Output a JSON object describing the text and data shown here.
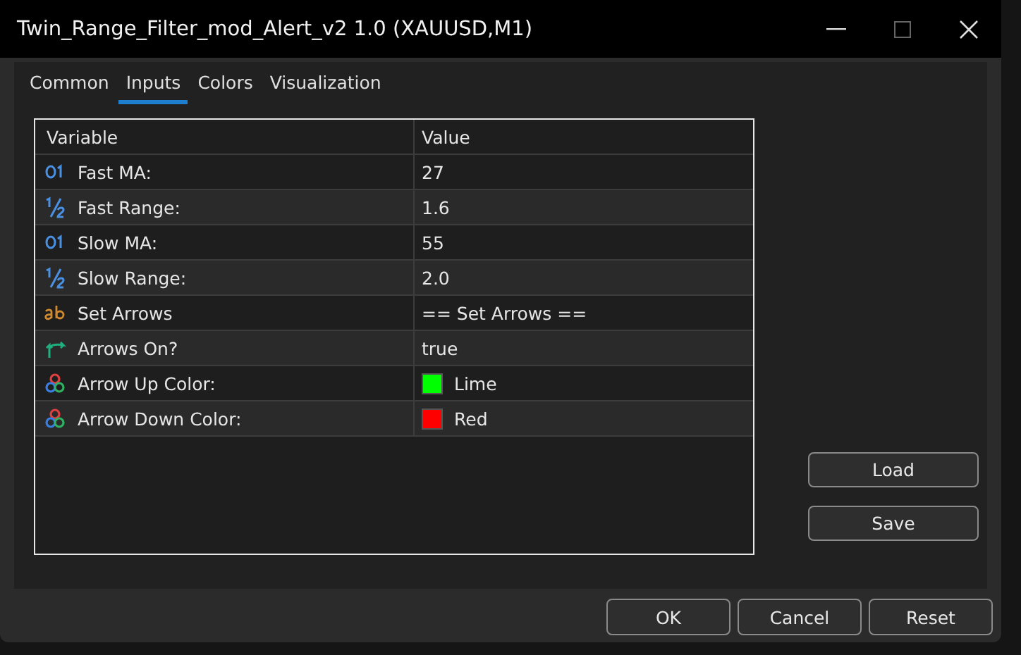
{
  "window": {
    "title": "Twin_Range_Filter_mod_Alert_v2 1.0 (XAUUSD,M1)"
  },
  "tabs": [
    {
      "label": "Common",
      "selected": false
    },
    {
      "label": "Inputs",
      "selected": true
    },
    {
      "label": "Colors",
      "selected": false
    },
    {
      "label": "Visualization",
      "selected": false
    }
  ],
  "table": {
    "columns": [
      "Variable",
      "Value"
    ],
    "rows": [
      {
        "kind": "int",
        "variable": "Fast MA:",
        "value": "27"
      },
      {
        "kind": "double",
        "variable": "Fast Range:",
        "value": "1.6"
      },
      {
        "kind": "int",
        "variable": "Slow MA:",
        "value": "55"
      },
      {
        "kind": "double",
        "variable": "Slow Range:",
        "value": "2.0"
      },
      {
        "kind": "string",
        "variable": "Set Arrows",
        "value": "== Set Arrows =="
      },
      {
        "kind": "bool",
        "variable": "Arrows On?",
        "value": "true"
      },
      {
        "kind": "color",
        "variable": "Arrow Up Color:",
        "value": "Lime",
        "color": "#00ff00"
      },
      {
        "kind": "color",
        "variable": "Arrow Down Color:",
        "value": "Red",
        "color": "#ff0000"
      }
    ]
  },
  "side_buttons": [
    "Load",
    "Save"
  ],
  "buttons": [
    "OK",
    "Cancel",
    "Reset"
  ]
}
